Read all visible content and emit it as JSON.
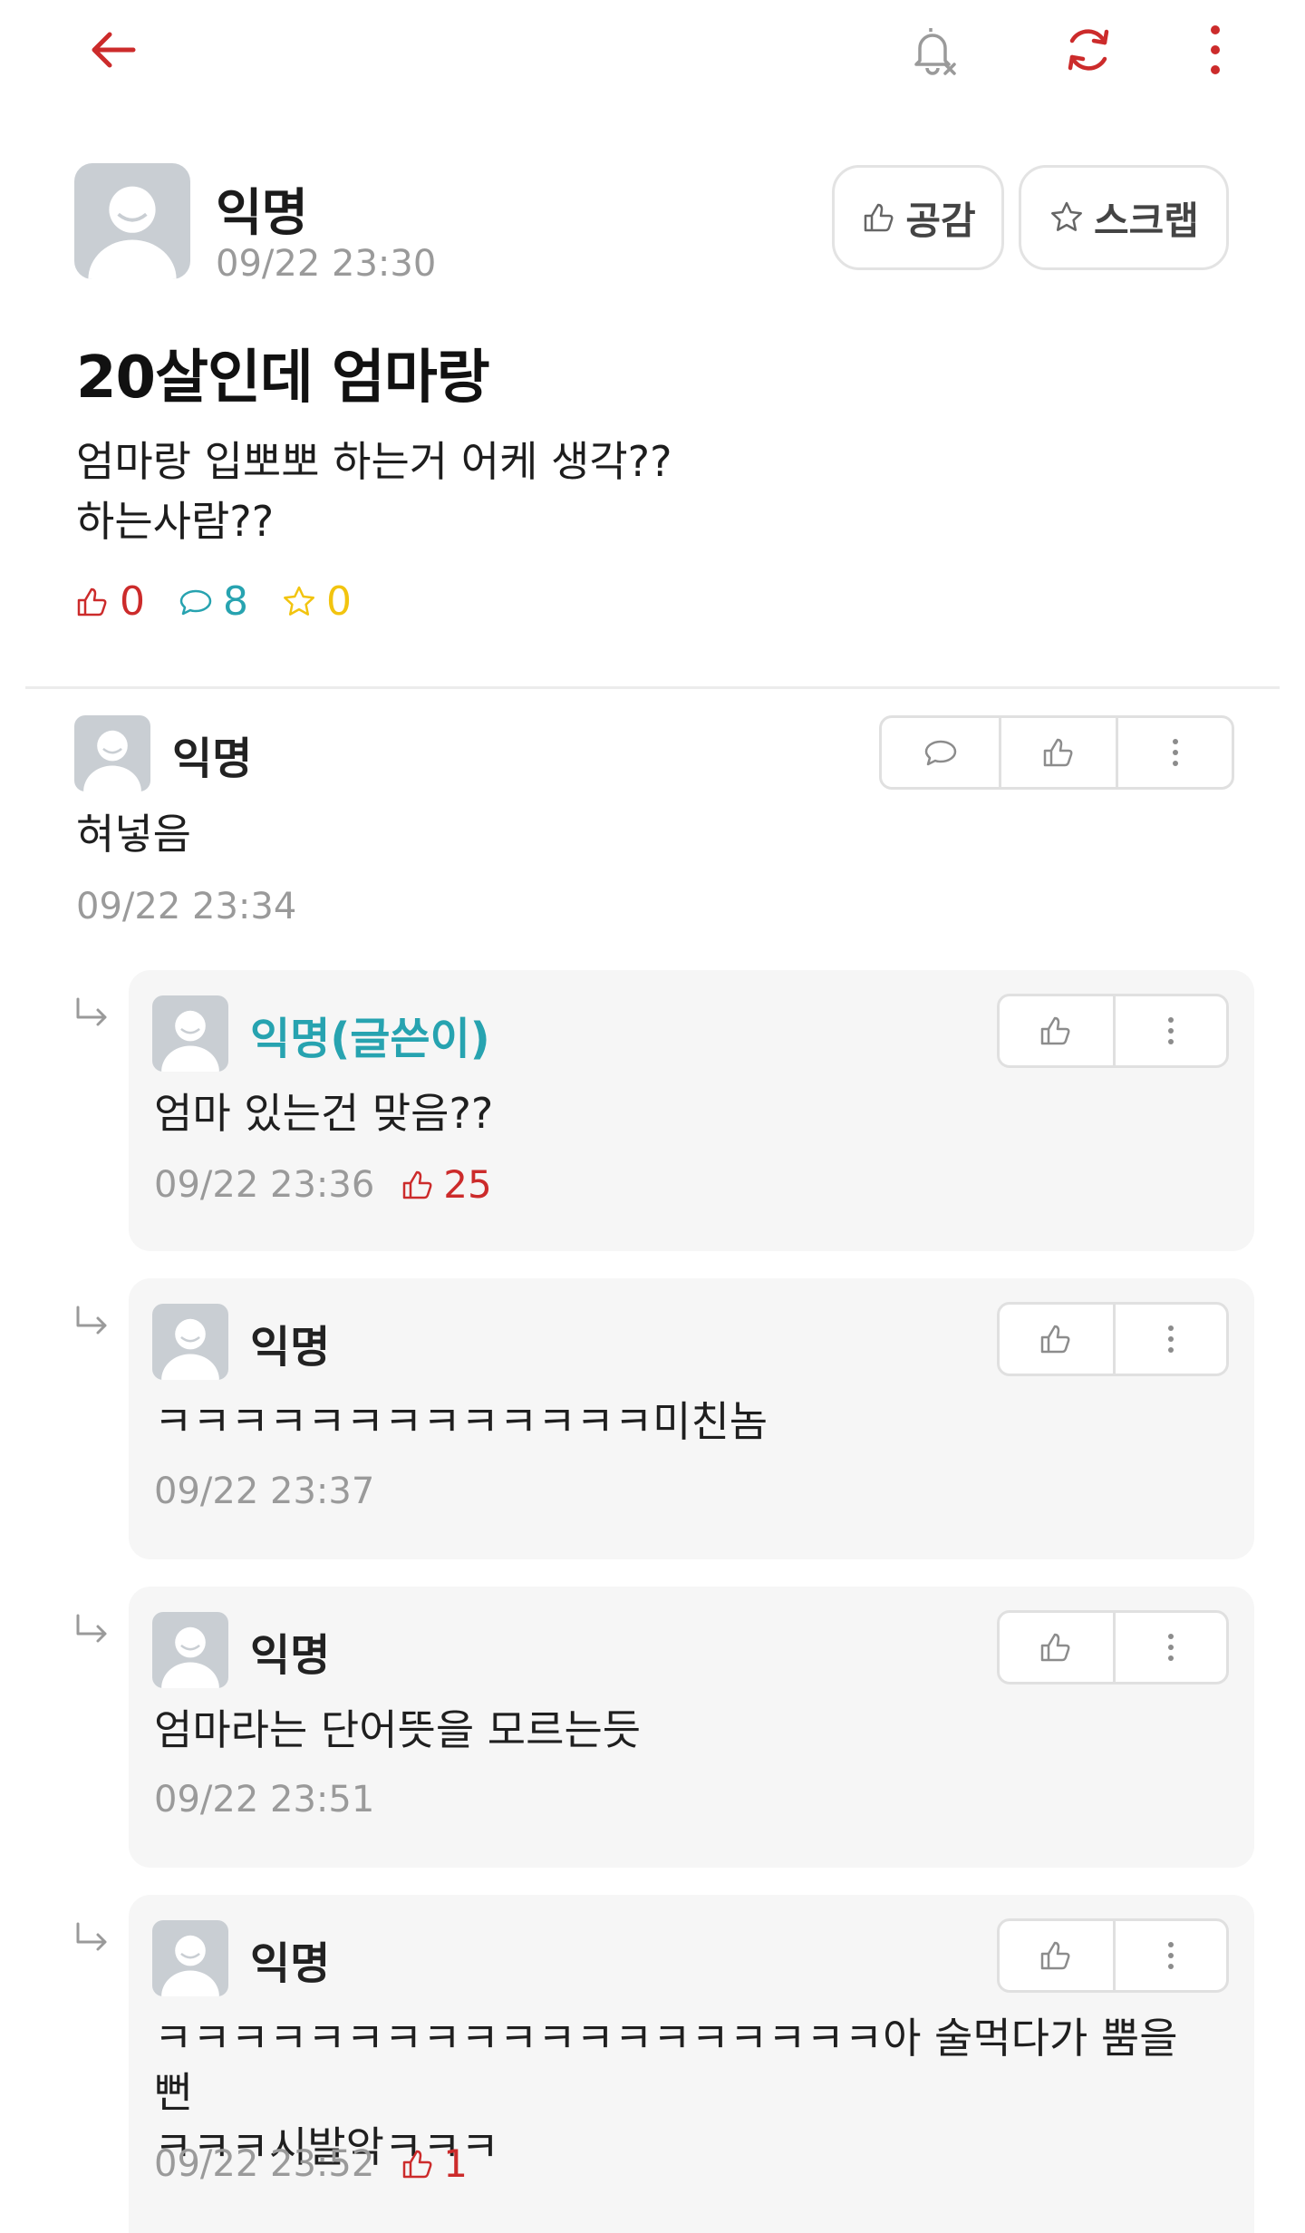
{
  "colors": {
    "accent_red": "#cc2b2b",
    "comment_blue": "#27a3b0",
    "scrap_yellow": "#f2c40f",
    "muted": "#9a9a9a"
  },
  "topbar": {
    "back_icon": "arrow-left-icon",
    "bell_icon": "bell-off-icon",
    "refresh_icon": "refresh-icon",
    "more_icon": "more-vertical-icon"
  },
  "post": {
    "author": "익명",
    "time": "09/22 23:30",
    "like_button": "공감",
    "scrap_button": "스크랩",
    "title": "20살인데 엄마랑",
    "body_lines": [
      "엄마랑 입뽀뽀 하는거 어케 생각??",
      "하는사람??"
    ],
    "stats": {
      "likes": "0",
      "comments": "8",
      "scraps": "0"
    }
  },
  "comment": {
    "author": "익명",
    "text": "혀넣음",
    "time": "09/22 23:34"
  },
  "replies": [
    {
      "author": "익명(글쓴이)",
      "text": "엄마 있는건 맞음??",
      "time": "09/22 23:36",
      "likes": "25"
    },
    {
      "author": "익명",
      "text": "ㅋㅋㅋㅋㅋㅋㅋㅋㅋㅋㅋㅋㅋ미친놈",
      "time": "09/22 23:37",
      "likes": ""
    },
    {
      "author": "익명",
      "text": "엄마라는 단어뜻을 모르는듯",
      "time": "09/22 23:51",
      "likes": ""
    },
    {
      "author": "익명",
      "text_lines": [
        "ㅋㅋㅋㅋㅋㅋㅋㅋㅋㅋㅋㅋㅋㅋㅋㅋㅋㅋㅋ아 술먹다가 뿜을 뻔",
        "ㅋㅋㅋ시발악ㅋㅋㅋ"
      ],
      "time": "09/22 23:52",
      "likes": "1"
    }
  ]
}
